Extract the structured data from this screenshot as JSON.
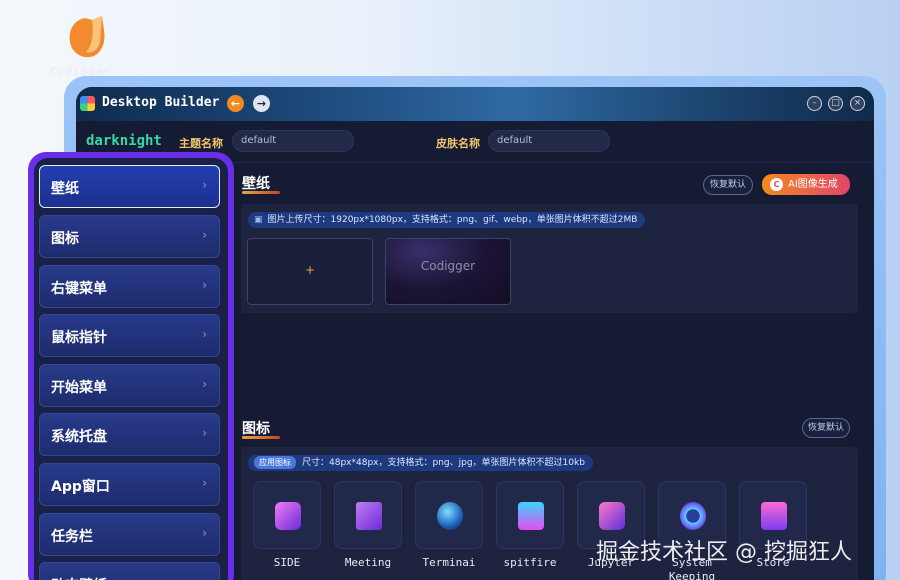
{
  "brand": {
    "logo_text": "Codigger"
  },
  "window": {
    "title": "Desktop Builder",
    "nav_back_icon": "←",
    "nav_forward_icon": "→",
    "controls": {
      "minimize": "–",
      "maximize": "□",
      "close": "×"
    }
  },
  "header": {
    "theme_id": "darknight",
    "theme_name_label": "主题名称",
    "theme_name_value": "default",
    "skin_name_label": "皮肤名称",
    "skin_name_value": "default"
  },
  "sidebar": {
    "items": [
      {
        "label": "壁纸",
        "active": true
      },
      {
        "label": "图标",
        "active": false
      },
      {
        "label": "右键菜单",
        "active": false
      },
      {
        "label": "鼠标指针",
        "active": false
      },
      {
        "label": "开始菜单",
        "active": false
      },
      {
        "label": "系统托盘",
        "active": false
      },
      {
        "label": "App窗口",
        "active": false
      },
      {
        "label": "任务栏",
        "active": false
      },
      {
        "label": "动态壁纸",
        "active": false
      }
    ],
    "chevron": "›"
  },
  "wallpaper_section": {
    "title": "壁纸",
    "reset_label": "恢复默认",
    "ai_label": "AI图像生成",
    "ai_icon_text": "C",
    "info_text": "图片上传尺寸：1920px*1080px，支持格式：png、gif、webp，单张图片体积不超过2MB",
    "upload_plus": "+",
    "thumbnail_text": "Codigger"
  },
  "icon_section": {
    "title": "图标",
    "reset_label": "恢复默认",
    "info_tag": "应用图标",
    "info_text": "尺寸：48px*48px，支持格式：png、jpg，单张图片体积不超过10kb",
    "icons": [
      {
        "label": "SIDE",
        "icon": "side-icon"
      },
      {
        "label": "Meeting",
        "icon": "meeting-icon"
      },
      {
        "label": "Terminai",
        "icon": "terminal-icon"
      },
      {
        "label": "spitfire",
        "icon": "spitfire-icon"
      },
      {
        "label": "Jupyter",
        "icon": "jupyter-icon"
      },
      {
        "label": "System Keeping",
        "icon": "gear-icon"
      },
      {
        "label": "Store",
        "icon": "store-icon"
      }
    ]
  },
  "watermark": "掘金技术社区 @ 挖掘狂人"
}
